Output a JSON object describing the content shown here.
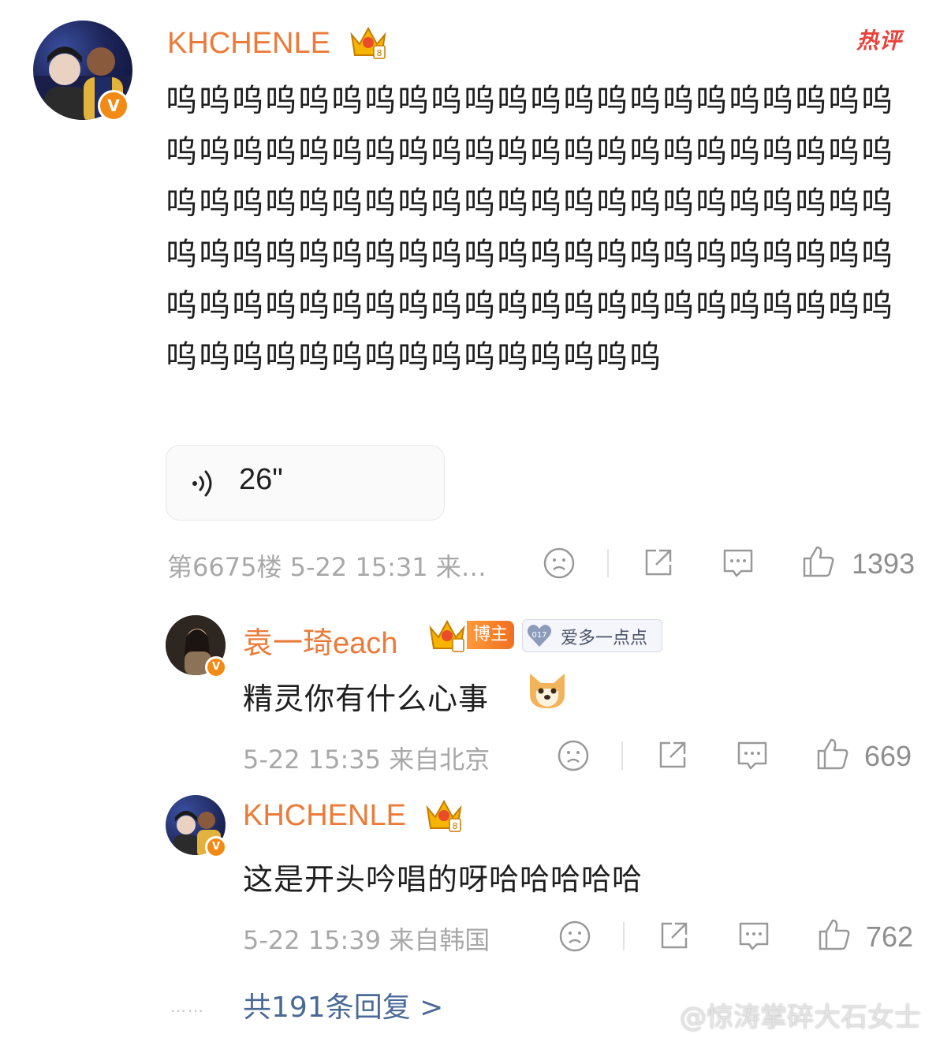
{
  "comment": {
    "username": "KHCHENLE",
    "hot_tag": "热评",
    "verified_mark": "V",
    "text": "呜呜呜呜呜呜呜呜呜呜呜呜呜呜呜呜呜呜呜呜呜呜呜呜呜呜呜呜呜呜呜呜呜呜呜呜呜呜呜呜呜呜呜呜呜呜呜呜呜呜呜呜呜呜呜呜呜呜呜呜呜呜呜呜呜呜呜呜呜呜呜呜呜呜呜呜呜呜呜呜呜呜呜呜呜呜呜呜呜呜呜呜呜呜呜呜呜呜呜呜呜呜呜呜呜呜呜呜呜呜呜呜呜呜呜呜呜呜呜呜呜呜呜呜呜",
    "voice_duration": "26\"",
    "meta": "第6675楼 5-22 15:31 来…",
    "like_count": "1393"
  },
  "replies": [
    {
      "username": "袁一琦each",
      "verified_mark": "V",
      "blogger_badge": "博主",
      "fan_badge_level": "017",
      "fan_badge_text": "爱多一点点",
      "text": "精灵你有什么心事",
      "emoji": "dog-face-emoji",
      "meta": "5-22 15:35 来自北京",
      "like_count": "669"
    },
    {
      "username": "KHCHENLE",
      "verified_mark": "V",
      "text": "这是开头吟唱的呀哈哈哈哈哈",
      "meta": "5-22 15:39 来自韩国",
      "like_count": "762"
    }
  ],
  "more_replies": "共191条回复 >",
  "dots": "……",
  "watermark": "@惊涛掌碎大石女士",
  "icons": [
    "sad-face-icon",
    "share-icon",
    "comment-icon",
    "thumbs-up-icon",
    "crown-badge-icon",
    "sound-wave-icon"
  ],
  "colors": {
    "username": "#eb7b3b",
    "hot": "#e8423a",
    "verified": "#f28a16",
    "link": "#4a6a95",
    "meta": "#a8a8a8"
  }
}
